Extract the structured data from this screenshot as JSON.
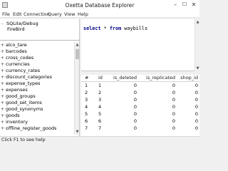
{
  "window": {
    "title": "Oxetta Database Explorer",
    "minimize_glyph": "–",
    "maximize_glyph": "☐",
    "close_glyph": "✕"
  },
  "menu": {
    "items": [
      "File",
      "Edit",
      "Connection",
      "Query",
      "View",
      "Help"
    ]
  },
  "sidebar": {
    "connection": {
      "toggle": "-",
      "name": "SQLite/Debug",
      "child": "FireBird"
    },
    "tables": [
      {
        "toggle": "+",
        "name": "alco_tare"
      },
      {
        "toggle": "+",
        "name": "barcodes"
      },
      {
        "toggle": "+",
        "name": "cross_codes"
      },
      {
        "toggle": "+",
        "name": "currencies"
      },
      {
        "toggle": "+",
        "name": "currency_rates"
      },
      {
        "toggle": "+",
        "name": "discount_categories"
      },
      {
        "toggle": "+",
        "name": "expense_types"
      },
      {
        "toggle": "+",
        "name": "expenses"
      },
      {
        "toggle": "+",
        "name": "good_groups"
      },
      {
        "toggle": "+",
        "name": "good_set_items"
      },
      {
        "toggle": "+",
        "name": "good_synonyms"
      },
      {
        "toggle": "+",
        "name": "goods"
      },
      {
        "toggle": "+",
        "name": "inventory"
      },
      {
        "toggle": "+",
        "name": "offline_register_goods"
      }
    ]
  },
  "editor": {
    "keyword_select": "select",
    "star": " * ",
    "keyword_from": "from",
    "table": " waybills"
  },
  "grid": {
    "columns": [
      "#",
      "id",
      "is_deleted",
      "is_replicated",
      "shop_id"
    ],
    "rows": [
      [
        "1",
        "1",
        "0",
        "0",
        "0"
      ],
      [
        "2",
        "2",
        "0",
        "0",
        "0"
      ],
      [
        "3",
        "3",
        "0",
        "0",
        "0"
      ],
      [
        "4",
        "4",
        "0",
        "0",
        "0"
      ],
      [
        "5",
        "5",
        "0",
        "0",
        "0"
      ],
      [
        "6",
        "6",
        "0",
        "0",
        "0"
      ],
      [
        "7",
        "7",
        "0",
        "0",
        "0"
      ]
    ]
  },
  "status": {
    "text": "Click F1 to see help"
  }
}
